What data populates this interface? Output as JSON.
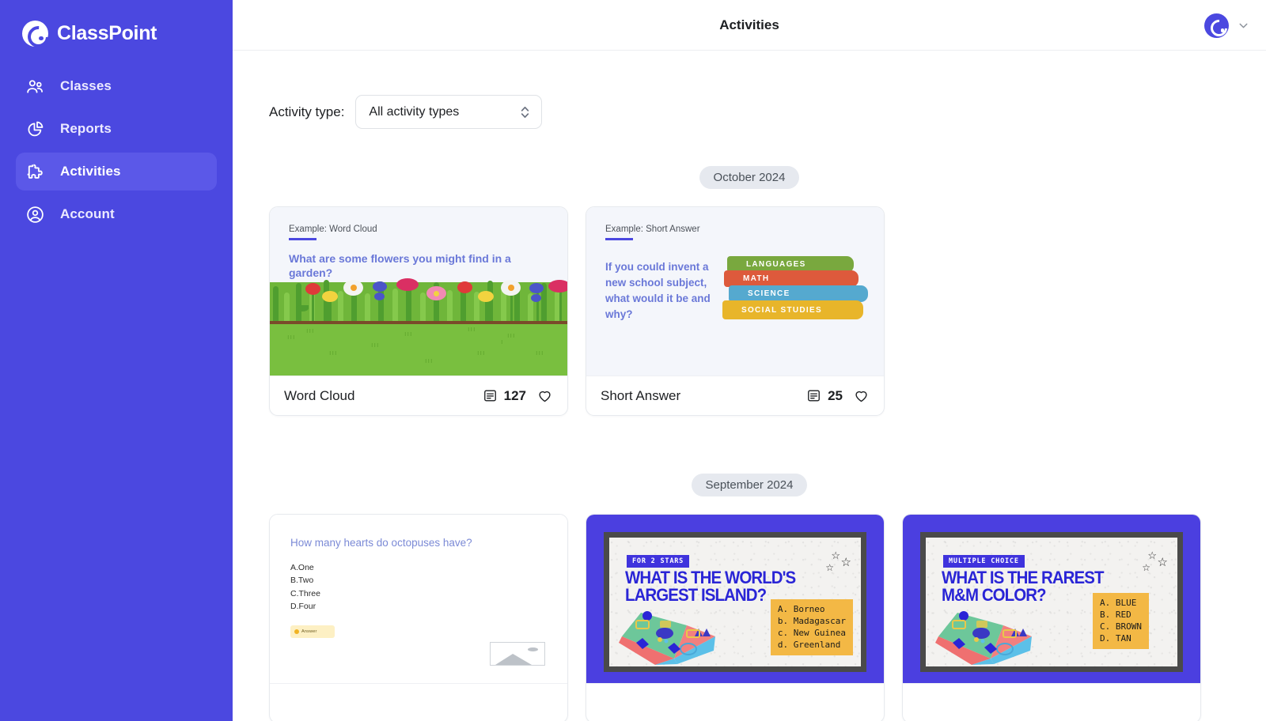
{
  "sidebar": {
    "brand": "ClassPoint",
    "items": [
      {
        "label": "Classes",
        "icon": "people-icon"
      },
      {
        "label": "Reports",
        "icon": "pie-chart-icon"
      },
      {
        "label": "Activities",
        "icon": "puzzle-piece-icon"
      },
      {
        "label": "Account",
        "icon": "user-circle-icon"
      }
    ],
    "active_index": 2,
    "bg_color": "#4B48E0",
    "active_bg_color": "#5B58E8"
  },
  "topbar": {
    "title": "Activities",
    "avatar_label": "C",
    "chevron_icon": "chevron-down-icon"
  },
  "filter": {
    "label": "Activity type:",
    "selected": "All activity types",
    "options": [
      "All activity types"
    ],
    "stepper_icon": "stepper-updown-icon"
  },
  "sections": [
    {
      "month": "October 2024",
      "cards": [
        {
          "title": "Word Cloud",
          "count": "127",
          "count_icon": "slide-icon",
          "heart_icon": "heart-outline-icon",
          "thumb_kind": "word-cloud",
          "kicker": "Example: Word Cloud",
          "question": "What are some flowers you might find in a garden?"
        },
        {
          "title": "Short Answer",
          "count": "25",
          "count_icon": "slide-icon",
          "heart_icon": "heart-outline-icon",
          "thumb_kind": "short-answer",
          "kicker": "Example: Short Answer",
          "question": "If you could invent a new school subject, what would it be and why?",
          "books": [
            "LANGUAGES",
            "MATH",
            "SCIENCE",
            "SOCIAL STUDIES"
          ]
        }
      ]
    },
    {
      "month": "September 2024",
      "cards": [
        {
          "title": "",
          "count": "",
          "thumb_kind": "octopus-mcq",
          "question": "How many hearts do octopuses have?",
          "options": [
            "A.One",
            "B.Two",
            "C.Three",
            "D.Four"
          ],
          "answer_label": "Answer"
        },
        {
          "title": "",
          "count": "",
          "thumb_kind": "quiz-slide",
          "tag": "FOR 2 STARS",
          "title_line1": "WHAT IS THE WORLD'S",
          "title_line2": "LARGEST ISLAND?",
          "options": [
            "A.  Borneo",
            "b.  Madagascar",
            "c.  New Guinea",
            "d.  Greenland"
          ]
        },
        {
          "title": "",
          "count": "",
          "thumb_kind": "quiz-slide",
          "tag": "MULTIPLE CHOICE",
          "title_line1": "WHAT IS THE RAREST",
          "title_line2": "M&M COLOR?",
          "options": [
            "A.  BLUE",
            "B.  RED",
            "C.  BROWN",
            "D.  TAN"
          ]
        }
      ]
    }
  ],
  "colors": {
    "brand_purple": "#4B48E0",
    "quiz_blue": "#2A25D6",
    "quiz_amber": "#F3B845",
    "badge_grey": "#E6E9EF",
    "question_violet": "#6A78D8"
  }
}
